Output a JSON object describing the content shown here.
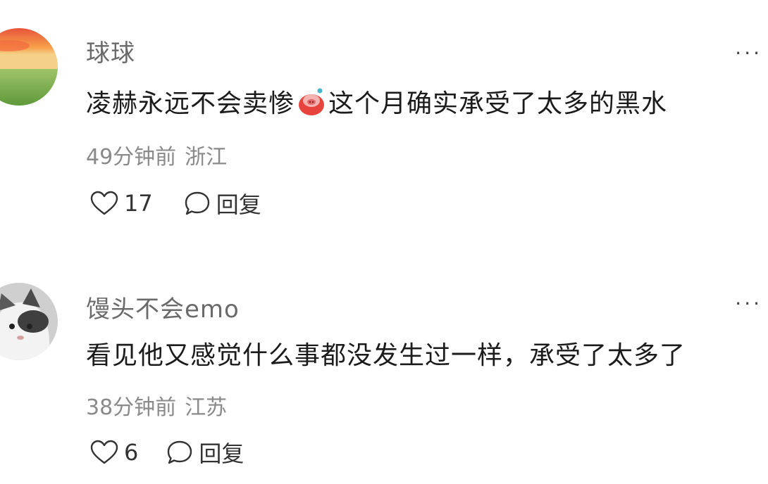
{
  "comments": [
    {
      "username": "球球",
      "text_before": "凌赫永远不会卖惨",
      "text_after": "这个月确实承受了太多的黑水",
      "emoji_icon": "pig-face-emoji",
      "time": "49分钟前",
      "location": "浙江",
      "likes": "17",
      "reply_label": "回复",
      "more_label": "···"
    },
    {
      "username": "馒头不会emo",
      "text_before": "看见他又感觉什么事都没发生过一样，承受了太多了",
      "time": "38分钟前",
      "location": "江苏",
      "likes": "6",
      "reply_label": "回复",
      "more_label": "···"
    }
  ]
}
